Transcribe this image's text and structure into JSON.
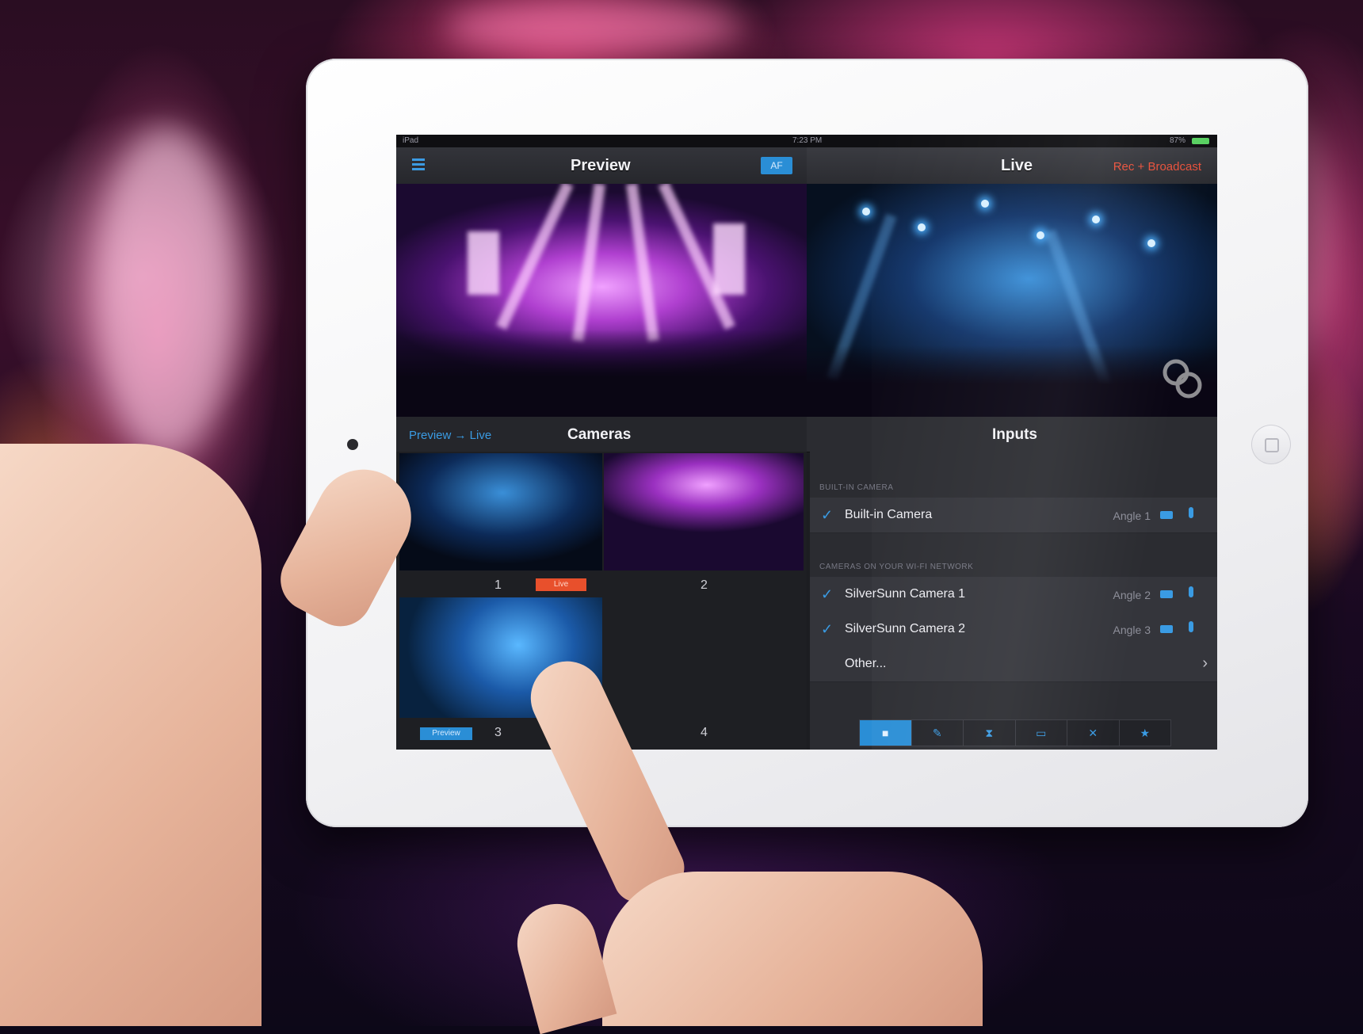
{
  "status_bar": {
    "carrier": "iPad",
    "time": "7:23 PM",
    "battery": "87%"
  },
  "preview_panel": {
    "title": "Preview",
    "af_label": "AF"
  },
  "live_panel": {
    "title": "Live",
    "rec_label": "Rec + Broadcast"
  },
  "cameras_section": {
    "link_label": "Preview → Live",
    "title": "Cameras",
    "cells": [
      {
        "number": "1",
        "badge": "Live"
      },
      {
        "number": "2",
        "badge": ""
      },
      {
        "number": "3",
        "badge": "Preview"
      },
      {
        "number": "4",
        "badge": ""
      }
    ]
  },
  "inputs_section": {
    "title": "Inputs",
    "groups": [
      {
        "header": "BUILT-IN CAMERA",
        "items": [
          {
            "name": "Built-in Camera",
            "angle": "Angle 1",
            "checked": true
          }
        ]
      },
      {
        "header": "CAMERAS ON YOUR WI-FI NETWORK",
        "items": [
          {
            "name": "SilverSunn Camera 1",
            "angle": "Angle 2",
            "checked": true
          },
          {
            "name": "SilverSunn Camera 2",
            "angle": "Angle 3",
            "checked": true
          },
          {
            "name": "Other...",
            "angle": "",
            "checked": false
          }
        ]
      }
    ],
    "tabs": [
      {
        "icon": "video-camera-icon",
        "glyph": "■",
        "active": true
      },
      {
        "icon": "effects-icon",
        "glyph": "✎",
        "active": false
      },
      {
        "icon": "transition-icon",
        "glyph": "⧗",
        "active": false
      },
      {
        "icon": "titles-icon",
        "glyph": "▭",
        "active": false
      },
      {
        "icon": "tools-icon",
        "glyph": "✕",
        "active": false
      },
      {
        "icon": "favorites-icon",
        "glyph": "★",
        "active": false
      }
    ]
  },
  "colors": {
    "accent_blue": "#2a8ed6",
    "live_red": "#e8502c",
    "panel_dark": "#1c1d21"
  }
}
